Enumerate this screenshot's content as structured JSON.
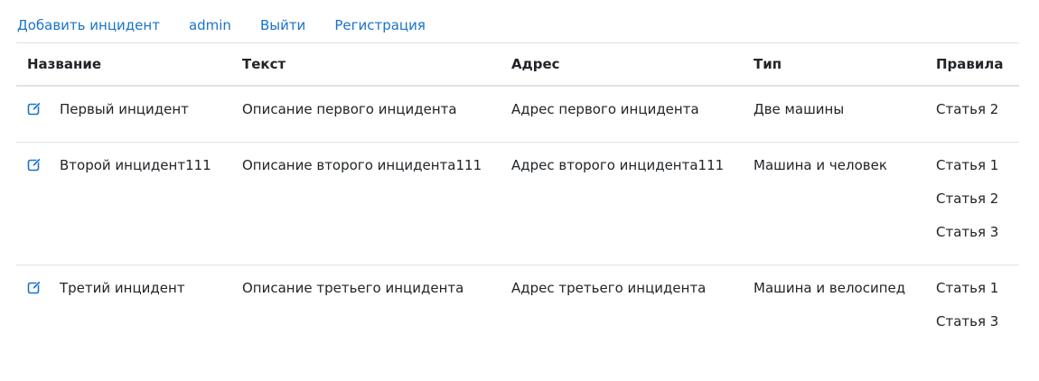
{
  "nav": {
    "add_incident": "Добавить инцидент",
    "user": "admin",
    "logout": "Выйти",
    "register": "Регистрация"
  },
  "table": {
    "headers": {
      "name": "Название",
      "text": "Текст",
      "address": "Адрес",
      "type": "Тип",
      "rules": "Правила"
    },
    "rows": [
      {
        "name": "Первый инцидент",
        "text": "Описание первого инцидента",
        "address": "Адрес первого инцидента",
        "type": "Две машины",
        "rules": [
          "Статья 2"
        ]
      },
      {
        "name": "Второй инцидент111",
        "text": "Описание второго инцидента111",
        "address": "Адрес второго инцидента111",
        "type": "Машина и человек",
        "rules": [
          "Статья 1",
          "Статья 2",
          "Статья 3"
        ]
      },
      {
        "name": "Третий инцидент",
        "text": "Описание третьего инцидента",
        "address": "Адрес третьего инцидента",
        "type": "Машина и велосипед",
        "rules": [
          "Статья 1",
          "Статья 3"
        ]
      }
    ]
  },
  "colors": {
    "link": "#1a73c9",
    "border": "#dee2e6",
    "text": "#212529"
  },
  "icons": {
    "edit": "edit-icon"
  }
}
